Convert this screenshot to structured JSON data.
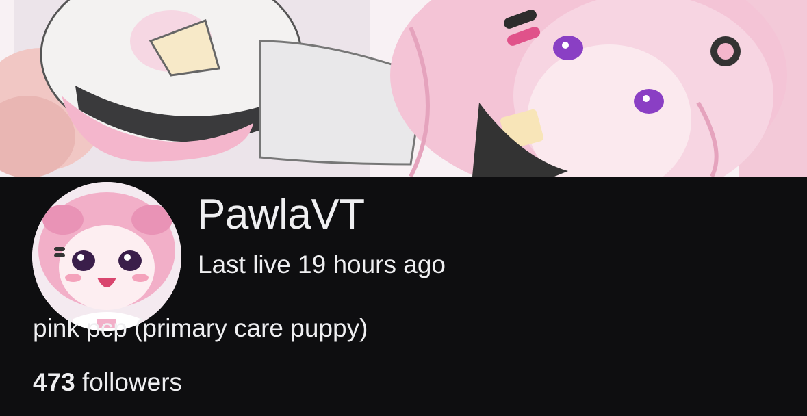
{
  "channel": {
    "name": "PawlaVT",
    "last_live": "Last live 19 hours ago",
    "bio": "pink pcp (primary care puppy)",
    "followers_count": "473",
    "followers_label": "followers"
  },
  "colors": {
    "background": "#0e0e10",
    "text": "#efeff1",
    "banner_pink": "#f4b6cc",
    "eye_purple": "#8a3fc4"
  },
  "icons": {
    "banner": "pink-anime-character-banner-art",
    "avatar": "pink-anime-character-avatar"
  }
}
